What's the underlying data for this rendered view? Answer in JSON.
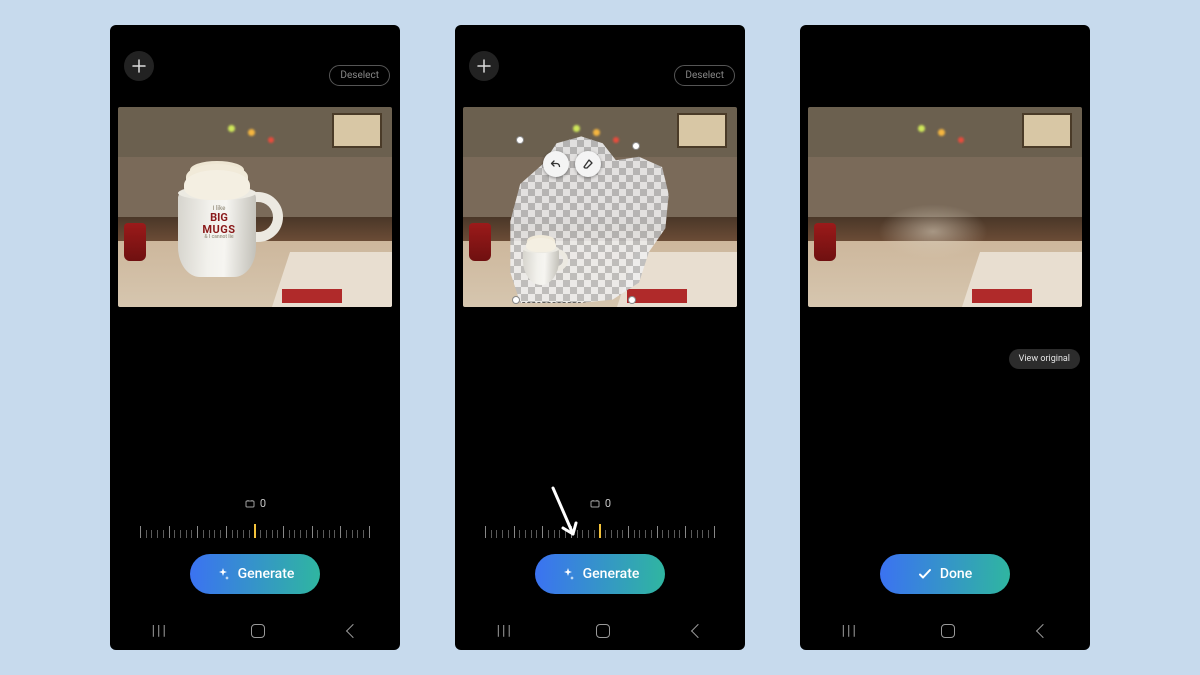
{
  "screen1": {
    "deselect_label": "Deselect",
    "angle_value": "0",
    "generate_label": "Generate",
    "mug_text": {
      "l1": "I like",
      "l2": "BIG",
      "l3": "MUGS",
      "l4": "& I cannot lie"
    }
  },
  "screen2": {
    "deselect_label": "Deselect",
    "angle_value": "0",
    "generate_label": "Generate"
  },
  "screen3": {
    "view_original_label": "View original",
    "done_label": "Done"
  }
}
